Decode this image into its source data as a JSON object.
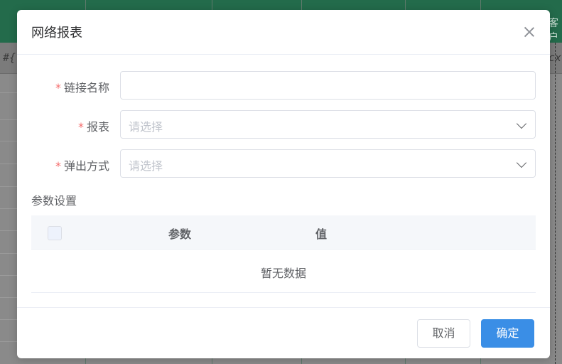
{
  "background": {
    "header_text": "客户",
    "formula_left": "#{f",
    "formula_right": "cx."
  },
  "dialog": {
    "title": "网络报表",
    "fields": [
      {
        "label": "链接名称",
        "required": true,
        "type": "input",
        "value": ""
      },
      {
        "label": "报表",
        "required": true,
        "type": "select",
        "placeholder": "请选择"
      },
      {
        "label": "弹出方式",
        "required": true,
        "type": "select",
        "placeholder": "请选择"
      }
    ],
    "params_section_title": "参数设置",
    "table": {
      "columns": [
        "参数",
        "值"
      ],
      "empty_text": "暂无数据"
    },
    "buttons": {
      "cancel": "取消",
      "ok": "确定"
    }
  },
  "colors": {
    "primary": "#3a8ee6",
    "required": "#f56c6c",
    "sheet_header": "#236b4b"
  }
}
